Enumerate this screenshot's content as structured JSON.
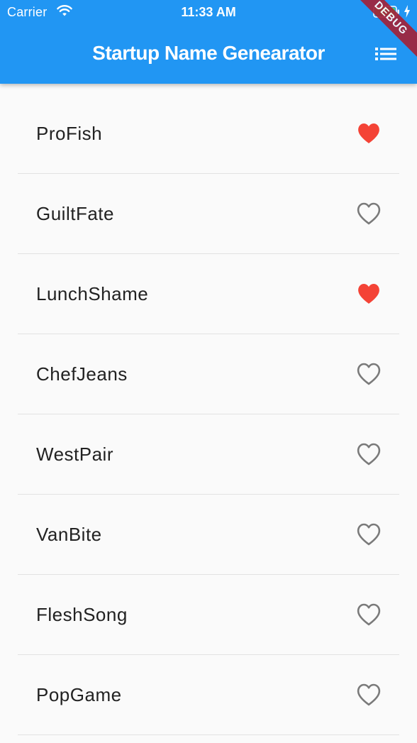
{
  "status_bar": {
    "carrier": "Carrier",
    "time": "11:33 AM",
    "icons": [
      "wifi-icon",
      "battery-icon",
      "charging-bolt-icon"
    ]
  },
  "app_bar": {
    "title": "Startup Name Genearator",
    "action_icon": "list-icon",
    "background_color": "#2196f3"
  },
  "debug_banner": {
    "label": "DEBUG",
    "color": "#a32339"
  },
  "saved_color": "#f44336",
  "unsaved_color": "#7a7a7a",
  "suggestions": [
    {
      "name": "ProFish",
      "saved": true
    },
    {
      "name": "GuiltFate",
      "saved": false
    },
    {
      "name": "LunchShame",
      "saved": true
    },
    {
      "name": "ChefJeans",
      "saved": false
    },
    {
      "name": "WestPair",
      "saved": false
    },
    {
      "name": "VanBite",
      "saved": false
    },
    {
      "name": "FleshSong",
      "saved": false
    },
    {
      "name": "PopGame",
      "saved": false
    }
  ]
}
